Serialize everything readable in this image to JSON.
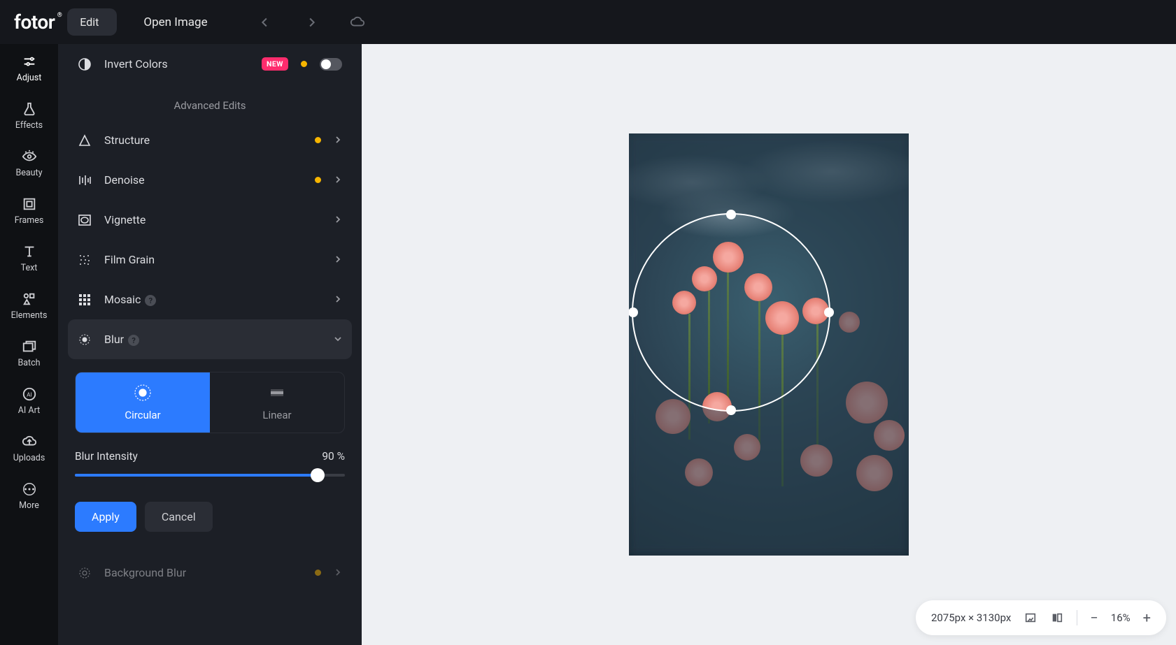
{
  "header": {
    "logo": "fotor",
    "edit_label": "Edit",
    "open_image_label": "Open Image"
  },
  "sidenav": {
    "items": [
      {
        "label": "Adjust"
      },
      {
        "label": "Effects"
      },
      {
        "label": "Beauty"
      },
      {
        "label": "Frames"
      },
      {
        "label": "Text"
      },
      {
        "label": "Elements"
      },
      {
        "label": "Batch"
      },
      {
        "label": "AI Art"
      },
      {
        "label": "Uploads"
      },
      {
        "label": "More"
      }
    ]
  },
  "panel": {
    "invert_colors_label": "Invert Colors",
    "new_badge": "NEW",
    "advanced_edits_title": "Advanced Edits",
    "structure_label": "Structure",
    "denoise_label": "Denoise",
    "vignette_label": "Vignette",
    "film_grain_label": "Film Grain",
    "mosaic_label": "Mosaic",
    "blur_label": "Blur",
    "background_blur_label": "Background Blur"
  },
  "blur": {
    "circular_label": "Circular",
    "linear_label": "Linear",
    "intensity_label": "Blur Intensity",
    "intensity_value": "90",
    "intensity_unit": "%",
    "intensity_percent": 90,
    "apply_label": "Apply",
    "cancel_label": "Cancel"
  },
  "statusbar": {
    "dimensions": "2075px × 3130px",
    "zoom": "16%"
  },
  "colors": {
    "accent": "#2c7bff",
    "badge_pink": "#ff2c6d",
    "premium_dot": "#f7b500"
  }
}
